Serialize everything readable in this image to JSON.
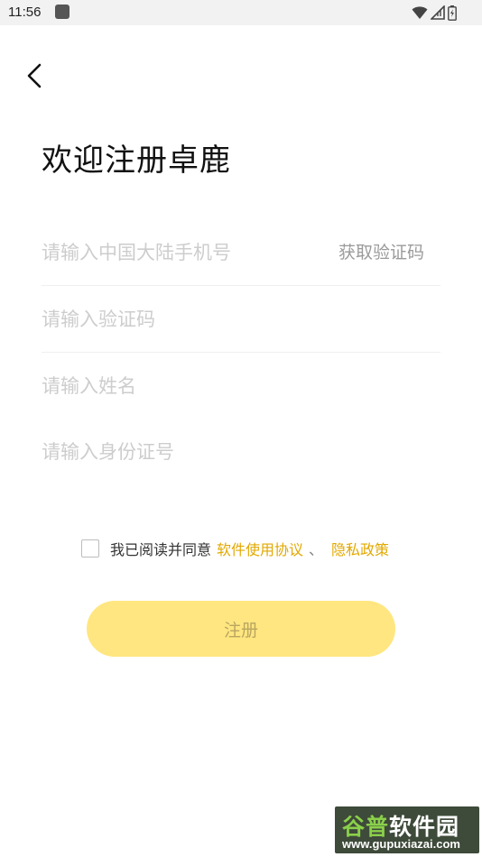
{
  "status_bar": {
    "time": "11:56",
    "icons": [
      "app-notification-icon",
      "wifi-icon",
      "signal-icon",
      "battery-icon"
    ]
  },
  "header": {
    "back_icon": "chevron-left-icon",
    "title": "欢迎注册卓鹿"
  },
  "form": {
    "phone_placeholder": "请输入中国大陆手机号",
    "get_code_label": "获取验证码",
    "code_placeholder": "请输入验证码",
    "name_placeholder": "请输入姓名",
    "id_placeholder": "请输入身份证号"
  },
  "agreement": {
    "checked": false,
    "prefix": "我已阅读并同意",
    "terms_link": "软件使用协议",
    "separator": "、",
    "privacy_link": "隐私政策"
  },
  "register_label": "注册",
  "watermark": {
    "title_part1": "谷普",
    "title_part2": "软件园",
    "url": "www.gupuxiazai.com"
  },
  "colors": {
    "accent": "#e2a800",
    "button_bg": "#ffe680",
    "button_text": "#b9a560",
    "placeholder": "#cdcdcd"
  }
}
